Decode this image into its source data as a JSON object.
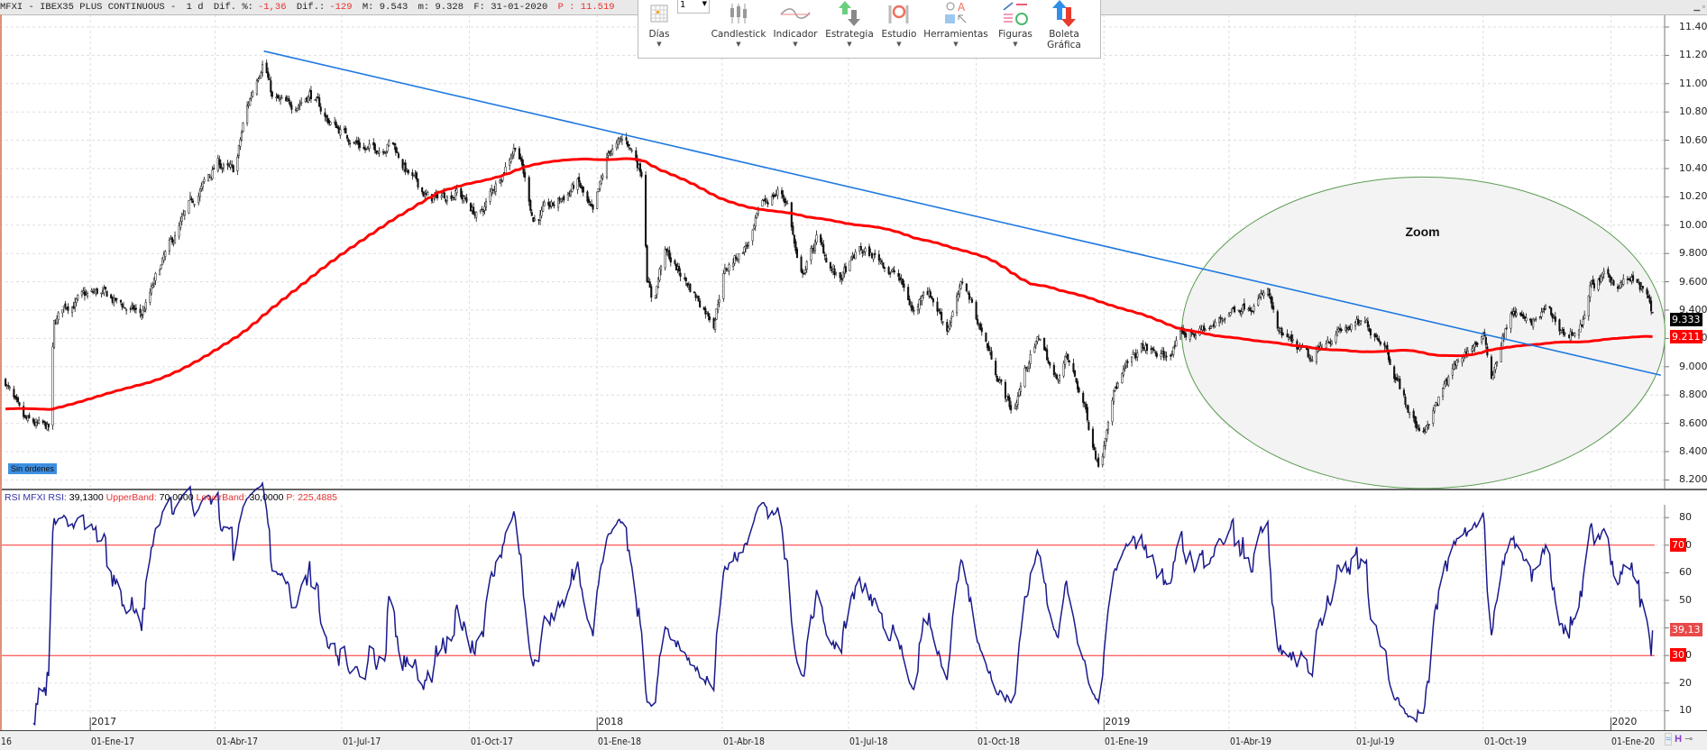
{
  "header": {
    "symbol": "MFXI - IBEX35 PLUS CONTINUOUS -",
    "period": "1 d",
    "dif_pct_label": "Dif. %:",
    "dif_pct": "-1,36",
    "dif_label": "Dif.:",
    "dif": "-129",
    "max": "M: 9.543",
    "min": "m: 9.328",
    "date": "F: 31-01-2020",
    "p": "P : 11.519"
  },
  "toolbar": {
    "interval_value": "1",
    "items": [
      {
        "label": "Días"
      },
      {
        "label": "Candlestick"
      },
      {
        "label": "Indicador"
      },
      {
        "label": "Estrategia"
      },
      {
        "label": "Estudio"
      },
      {
        "label": "Herramientas"
      },
      {
        "label": "Figuras"
      },
      {
        "label": "Boleta Gráfica"
      }
    ]
  },
  "orders_badge": "Sin órdenes",
  "rsi_header": {
    "name": "RSI MFXI RSI:",
    "value": "39,1300",
    "upper_label": "UpperBand:",
    "upper": "70,0000",
    "lower_label": "LowerBand:",
    "lower": "30,0000",
    "p": "P: 225,4885"
  },
  "colors": {
    "sma": "#ff0000",
    "trend": "#1f78e0",
    "rsi": "#1a1a8c",
    "band": "#ff3030",
    "ellipse": "#5a9a50"
  },
  "chart_data": {
    "type": "candlestick",
    "start_date": "2016-10-28",
    "x_unit": "days since start_date",
    "price_waypoints": [
      [
        4,
        8900
      ],
      [
        16,
        8600
      ],
      [
        35,
        8550
      ],
      [
        39,
        9280
      ],
      [
        47,
        9440
      ],
      [
        71,
        9520
      ],
      [
        86,
        9440
      ],
      [
        102,
        9360
      ],
      [
        118,
        9750
      ],
      [
        133,
        10050
      ],
      [
        141,
        10200
      ],
      [
        157,
        10440
      ],
      [
        169,
        10360
      ],
      [
        176,
        10750
      ],
      [
        184,
        11020
      ],
      [
        190,
        11210
      ],
      [
        196,
        10900
      ],
      [
        208,
        10820
      ],
      [
        223,
        10940
      ],
      [
        235,
        10750
      ],
      [
        251,
        10630
      ],
      [
        267,
        10520
      ],
      [
        282,
        10600
      ],
      [
        294,
        10360
      ],
      [
        310,
        10170
      ],
      [
        329,
        10250
      ],
      [
        345,
        10050
      ],
      [
        361,
        10370
      ],
      [
        372,
        10600
      ],
      [
        384,
        10050
      ],
      [
        400,
        10140
      ],
      [
        416,
        10300
      ],
      [
        427,
        10050
      ],
      [
        439,
        10520
      ],
      [
        451,
        10600
      ],
      [
        463,
        10370
      ],
      [
        466,
        9670
      ],
      [
        470,
        9440
      ],
      [
        478,
        9820
      ],
      [
        494,
        9600
      ],
      [
        514,
        9330
      ],
      [
        521,
        9670
      ],
      [
        541,
        9900
      ],
      [
        549,
        10140
      ],
      [
        561,
        10250
      ],
      [
        568,
        10140
      ],
      [
        576,
        9600
      ],
      [
        588,
        9900
      ],
      [
        604,
        9600
      ],
      [
        619,
        9820
      ],
      [
        635,
        9750
      ],
      [
        647,
        9630
      ],
      [
        659,
        9360
      ],
      [
        666,
        9600
      ],
      [
        682,
        9280
      ],
      [
        694,
        9600
      ],
      [
        706,
        9280
      ],
      [
        717,
        8980
      ],
      [
        729,
        8670
      ],
      [
        741,
        9060
      ],
      [
        749,
        9210
      ],
      [
        760,
        8900
      ],
      [
        768,
        9060
      ],
      [
        780,
        8750
      ],
      [
        792,
        8280
      ],
      [
        800,
        8820
      ],
      [
        811,
        8980
      ],
      [
        823,
        9130
      ],
      [
        839,
        9060
      ],
      [
        851,
        9210
      ],
      [
        862,
        9250
      ],
      [
        874,
        9280
      ],
      [
        886,
        9400
      ],
      [
        902,
        9470
      ],
      [
        913,
        9520
      ],
      [
        921,
        9210
      ],
      [
        933,
        9130
      ],
      [
        945,
        9020
      ],
      [
        956,
        9210
      ],
      [
        972,
        9280
      ],
      [
        984,
        9280
      ],
      [
        996,
        9210
      ],
      [
        1004,
        8980
      ],
      [
        1015,
        8670
      ],
      [
        1023,
        8520
      ],
      [
        1035,
        8750
      ],
      [
        1047,
        8980
      ],
      [
        1058,
        9130
      ],
      [
        1068,
        9210
      ],
      [
        1074,
        8940
      ],
      [
        1082,
        9210
      ],
      [
        1090,
        9400
      ],
      [
        1102,
        9280
      ],
      [
        1113,
        9400
      ],
      [
        1129,
        9210
      ],
      [
        1141,
        9330
      ],
      [
        1145,
        9560
      ],
      [
        1152,
        9610
      ],
      [
        1168,
        9600
      ],
      [
        1176,
        9610
      ],
      [
        1184,
        9520
      ],
      [
        1192,
        9333
      ]
    ],
    "last_close": "9.333",
    "sma_last": "9.211",
    "price_ticks": [
      "8.200",
      "8.400",
      "8.600",
      "8.800",
      "9.000",
      "9.200",
      "9.400",
      "9.600",
      "9.800",
      "10.000",
      "10.200",
      "10.400",
      "10.600",
      "10.800",
      "11.000",
      "11.200",
      "11.400"
    ],
    "ylim": [
      8200,
      11400
    ],
    "trendline": [
      [
        190,
        11230
      ],
      [
        1196,
        8940
      ]
    ],
    "ellipse": {
      "center": [
        1025,
        9240
      ],
      "radius_days": 174,
      "radius_price": 1100,
      "label": "Zoom"
    },
    "sma_period": 200,
    "rsi": {
      "period": 14,
      "ticks": [
        "10",
        "20",
        "30",
        "40",
        "50",
        "60",
        "70",
        "80"
      ],
      "upper": 70,
      "lower": 30,
      "upper_tag": "70",
      "lower_tag": "30",
      "last_tag": "39,13",
      "ylim": [
        0,
        88
      ]
    },
    "x_labels": [
      {
        "day": -1,
        "label": "16"
      },
      {
        "day": 65,
        "label": "01-Ene-17"
      },
      {
        "day": 155,
        "label": "01-Abr-17"
      },
      {
        "day": 246,
        "label": "01-Jul-17"
      },
      {
        "day": 338,
        "label": "01-Oct-17"
      },
      {
        "day": 430,
        "label": "01-Ene-18"
      },
      {
        "day": 520,
        "label": "01-Abr-18"
      },
      {
        "day": 611,
        "label": "01-Jul-18"
      },
      {
        "day": 703,
        "label": "01-Oct-18"
      },
      {
        "day": 795,
        "label": "01-Ene-19"
      },
      {
        "day": 885,
        "label": "01-Abr-19"
      },
      {
        "day": 976,
        "label": "01-Jul-19"
      },
      {
        "day": 1068,
        "label": "01-Oct-19"
      },
      {
        "day": 1160,
        "label": "01-Ene-20"
      }
    ],
    "year_labels": [
      {
        "day": 65,
        "label": "2017"
      },
      {
        "day": 430,
        "label": "2018"
      },
      {
        "day": 795,
        "label": "2019"
      },
      {
        "day": 1160,
        "label": "2020"
      }
    ]
  }
}
